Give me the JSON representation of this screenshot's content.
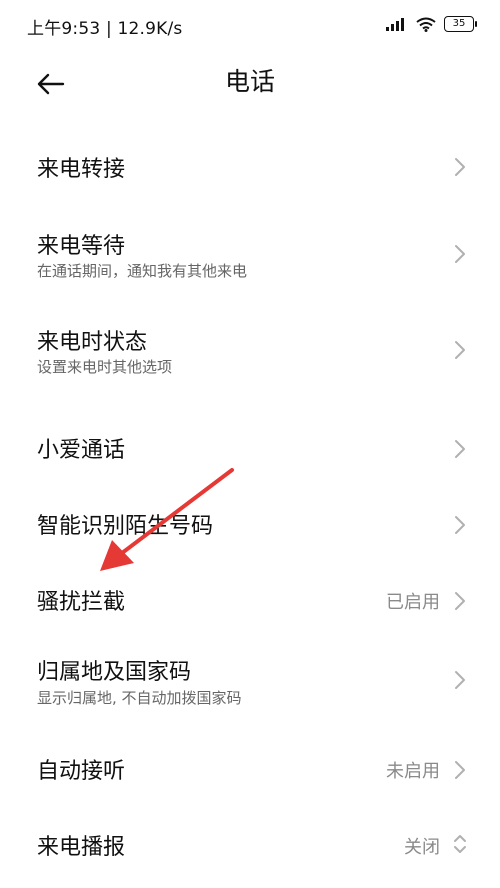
{
  "status_bar": {
    "time_speed": "上午9:53 | 12.9K/s",
    "battery": "35",
    "icons": [
      "signal-icon",
      "wifi-icon",
      "battery-icon"
    ]
  },
  "header": {
    "title": "电话",
    "back_icon": "arrow-left-icon"
  },
  "rows": [
    {
      "title": "来电转接",
      "subtitle": "",
      "value": "",
      "control": "chevron-right-icon"
    },
    {
      "title": "来电等待",
      "subtitle": "在通话期间，通知我有其他来电",
      "value": "",
      "control": "chevron-right-icon"
    },
    {
      "title": "来电时状态",
      "subtitle": "设置来电时其他选项",
      "value": "",
      "control": "chevron-right-icon"
    },
    {
      "title": "小爱通话",
      "subtitle": "",
      "value": "",
      "control": "chevron-right-icon"
    },
    {
      "title": "智能识别陌生号码",
      "subtitle": "",
      "value": "",
      "control": "chevron-right-icon"
    },
    {
      "title": "骚扰拦截",
      "subtitle": "",
      "value": "已启用",
      "control": "chevron-right-icon"
    },
    {
      "title": "归属地及国家码",
      "subtitle": "显示归属地, 不自动加拨国家码",
      "value": "",
      "control": "chevron-right-icon"
    },
    {
      "title": "自动接听",
      "subtitle": "",
      "value": "未启用",
      "control": "chevron-right-icon"
    },
    {
      "title": "来电播报",
      "subtitle": "",
      "value": "关闭",
      "control": "up-down-chevron-icon"
    }
  ],
  "annotation": {
    "color": "#e53935",
    "icon": "red-arrow-annotation"
  },
  "colors": {
    "background": "#ffffff",
    "text_primary": "#111111",
    "text_secondary": "#666666",
    "value_text": "#8a8a8a",
    "chevron": "#b0b0b0"
  }
}
